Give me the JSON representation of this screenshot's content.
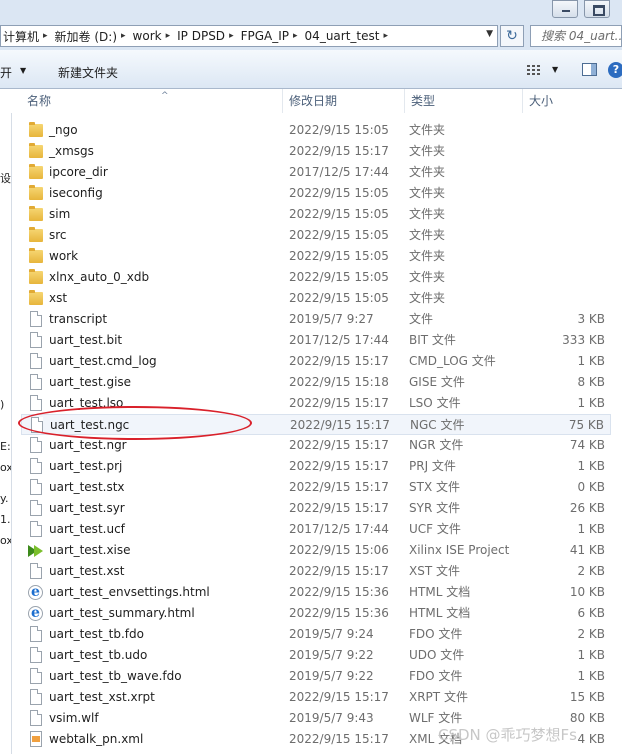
{
  "address": {
    "crumbs": [
      "计算机",
      "新加卷 (D:)",
      "work",
      "IP DPSD",
      "FPGA_IP",
      "04_uart_test"
    ],
    "search_placeholder": "搜索 04_uart..."
  },
  "toolbar": {
    "open_label": "开",
    "new_folder_label": "新建文件夹"
  },
  "columns": {
    "name": "名称",
    "date": "修改日期",
    "type": "类型",
    "size": "大小"
  },
  "left_nav_fragments": [
    "设",
    ")",
    "E:)",
    "ox",
    "y.",
    "1.",
    "ox"
  ],
  "files": [
    {
      "name": "_ngo",
      "date": "2022/9/15 15:05",
      "type": "文件夹",
      "size": "",
      "icon": "folder-icon"
    },
    {
      "name": "_xmsgs",
      "date": "2022/9/15 15:17",
      "type": "文件夹",
      "size": "",
      "icon": "folder-icon"
    },
    {
      "name": "ipcore_dir",
      "date": "2017/12/5 17:44",
      "type": "文件夹",
      "size": "",
      "icon": "folder-icon"
    },
    {
      "name": "iseconfig",
      "date": "2022/9/15 15:05",
      "type": "文件夹",
      "size": "",
      "icon": "folder-icon"
    },
    {
      "name": "sim",
      "date": "2022/9/15 15:05",
      "type": "文件夹",
      "size": "",
      "icon": "folder-icon"
    },
    {
      "name": "src",
      "date": "2022/9/15 15:05",
      "type": "文件夹",
      "size": "",
      "icon": "folder-icon"
    },
    {
      "name": "work",
      "date": "2022/9/15 15:05",
      "type": "文件夹",
      "size": "",
      "icon": "folder-icon"
    },
    {
      "name": "xlnx_auto_0_xdb",
      "date": "2022/9/15 15:05",
      "type": "文件夹",
      "size": "",
      "icon": "folder-icon"
    },
    {
      "name": "xst",
      "date": "2022/9/15 15:05",
      "type": "文件夹",
      "size": "",
      "icon": "folder-icon"
    },
    {
      "name": "transcript",
      "date": "2019/5/7 9:27",
      "type": "文件",
      "size": "3 KB",
      "icon": "file-icon"
    },
    {
      "name": "uart_test.bit",
      "date": "2017/12/5 17:44",
      "type": "BIT 文件",
      "size": "333 KB",
      "icon": "file-icon"
    },
    {
      "name": "uart_test.cmd_log",
      "date": "2022/9/15 15:17",
      "type": "CMD_LOG 文件",
      "size": "1 KB",
      "icon": "file-icon"
    },
    {
      "name": "uart_test.gise",
      "date": "2022/9/15 15:18",
      "type": "GISE 文件",
      "size": "8 KB",
      "icon": "file-icon"
    },
    {
      "name": "uart_test.lso",
      "date": "2022/9/15 15:17",
      "type": "LSO 文件",
      "size": "1 KB",
      "icon": "file-icon"
    },
    {
      "name": "uart_test.ngc",
      "date": "2022/9/15 15:17",
      "type": "NGC 文件",
      "size": "75 KB",
      "icon": "file-icon",
      "selected": true
    },
    {
      "name": "uart_test.ngr",
      "date": "2022/9/15 15:17",
      "type": "NGR 文件",
      "size": "74 KB",
      "icon": "file-icon"
    },
    {
      "name": "uart_test.prj",
      "date": "2022/9/15 15:17",
      "type": "PRJ 文件",
      "size": "1 KB",
      "icon": "file-icon"
    },
    {
      "name": "uart_test.stx",
      "date": "2022/9/15 15:17",
      "type": "STX 文件",
      "size": "0 KB",
      "icon": "file-icon"
    },
    {
      "name": "uart_test.syr",
      "date": "2022/9/15 15:17",
      "type": "SYR 文件",
      "size": "26 KB",
      "icon": "file-icon"
    },
    {
      "name": "uart_test.ucf",
      "date": "2017/12/5 17:44",
      "type": "UCF 文件",
      "size": "1 KB",
      "icon": "file-icon"
    },
    {
      "name": "uart_test.xise",
      "date": "2022/9/15 15:06",
      "type": "Xilinx ISE Project",
      "size": "41 KB",
      "icon": "xilinx-icon"
    },
    {
      "name": "uart_test.xst",
      "date": "2022/9/15 15:17",
      "type": "XST 文件",
      "size": "2 KB",
      "icon": "file-icon"
    },
    {
      "name": "uart_test_envsettings.html",
      "date": "2022/9/15 15:36",
      "type": "HTML 文档",
      "size": "10 KB",
      "icon": "ie-icon"
    },
    {
      "name": "uart_test_summary.html",
      "date": "2022/9/15 15:36",
      "type": "HTML 文档",
      "size": "6 KB",
      "icon": "ie-icon"
    },
    {
      "name": "uart_test_tb.fdo",
      "date": "2019/5/7 9:24",
      "type": "FDO 文件",
      "size": "2 KB",
      "icon": "file-icon"
    },
    {
      "name": "uart_test_tb.udo",
      "date": "2019/5/7 9:22",
      "type": "UDO 文件",
      "size": "1 KB",
      "icon": "file-icon"
    },
    {
      "name": "uart_test_tb_wave.fdo",
      "date": "2019/5/7 9:22",
      "type": "FDO 文件",
      "size": "1 KB",
      "icon": "file-icon"
    },
    {
      "name": "uart_test_xst.xrpt",
      "date": "2022/9/15 15:17",
      "type": "XRPT 文件",
      "size": "15 KB",
      "icon": "file-icon"
    },
    {
      "name": "vsim.wlf",
      "date": "2019/5/7 9:43",
      "type": "WLF 文件",
      "size": "80 KB",
      "icon": "file-icon"
    },
    {
      "name": "webtalk_pn.xml",
      "date": "2022/9/15 15:17",
      "type": "XML 文档",
      "size": "4 KB",
      "icon": "xml-icon"
    }
  ],
  "watermark": "CSDN @乖巧梦想Fs",
  "colors": {
    "highlight": "#d9212b",
    "folder": "#e7b53c",
    "accent": "#2c6cc0"
  }
}
